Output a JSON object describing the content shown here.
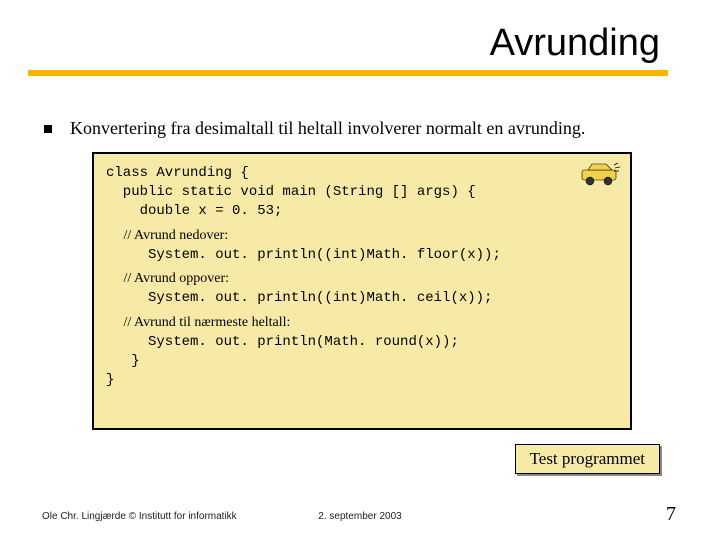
{
  "title": "Avrunding",
  "bullet": "Konvertering fra desimaltall til heltall involverer normalt en avrunding.",
  "code": {
    "l1": "class Avrunding {",
    "l2": "  public static void main (String [] args) {",
    "l3": "    double x = 0. 53;",
    "c1": "     // Avrund nedover:",
    "l4": "     System. out. println((int)Math. floor(x));",
    "c2": "     // Avrund oppover:",
    "l5": "     System. out. println((int)Math. ceil(x));",
    "c3": "     // Avrund til nærmeste heltall:",
    "l6": "     System. out. println(Math. round(x));",
    "l7": "   }",
    "l8": "}"
  },
  "button": "Test programmet",
  "footer": {
    "left": "Ole Chr. Lingjærde © Institutt for informatikk",
    "center": "2. september 2003",
    "right": "7"
  }
}
